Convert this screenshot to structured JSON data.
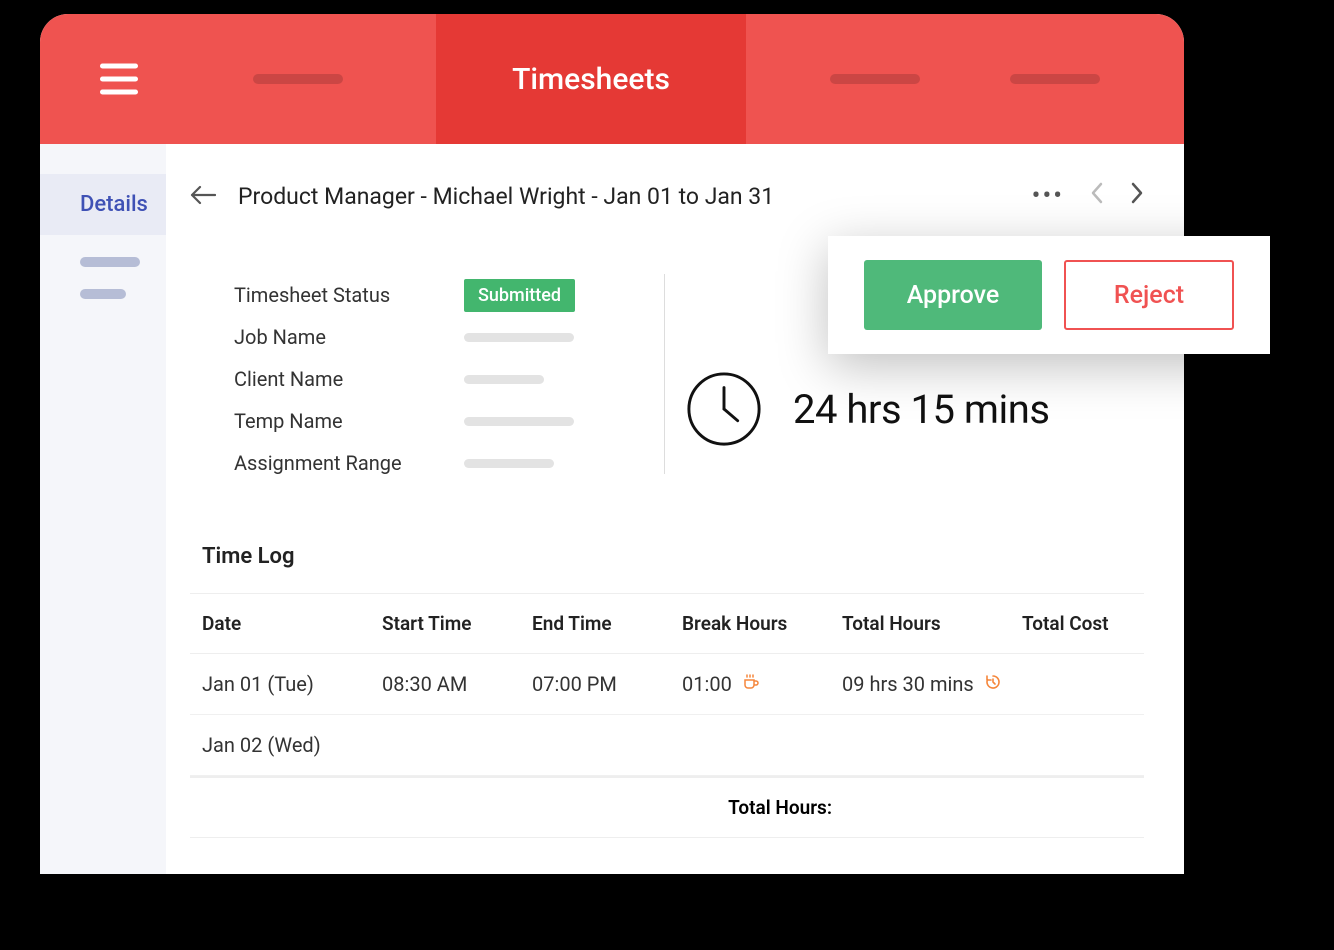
{
  "header": {
    "active_tab": "Timesheets"
  },
  "sidebar": {
    "active_label": "Details"
  },
  "breadcrumb": {
    "text": "Product Manager - Michael Wright  - Jan 01 to Jan 31"
  },
  "status": {
    "label": "Timesheet Status",
    "value": "Submitted"
  },
  "fields": {
    "job_name": "Job Name",
    "client_name": "Client Name",
    "temp_name": "Temp Name",
    "assignment_range": "Assignment Range"
  },
  "summary": {
    "total_time": "24 hrs 15 mins"
  },
  "actions": {
    "approve": "Approve",
    "reject": "Reject"
  },
  "timelog": {
    "section_title": "Time Log",
    "columns": {
      "date": "Date",
      "start_time": "Start Time",
      "end_time": "End Time",
      "break_hours": "Break Hours",
      "total_hours": "Total Hours",
      "total_cost": "Total Cost"
    },
    "rows": [
      {
        "date": "Jan 01 (Tue)",
        "start_time": "08:30 AM",
        "end_time": "07:00 PM",
        "break_hours": "01:00",
        "total_hours": "09 hrs 30 mins",
        "total_cost": null
      },
      {
        "date": "Jan 02 (Wed)",
        "start_time": null,
        "end_time": null,
        "break_hours": null,
        "total_hours": null,
        "total_cost": null
      }
    ],
    "footer_label": "Total Hours:"
  }
}
